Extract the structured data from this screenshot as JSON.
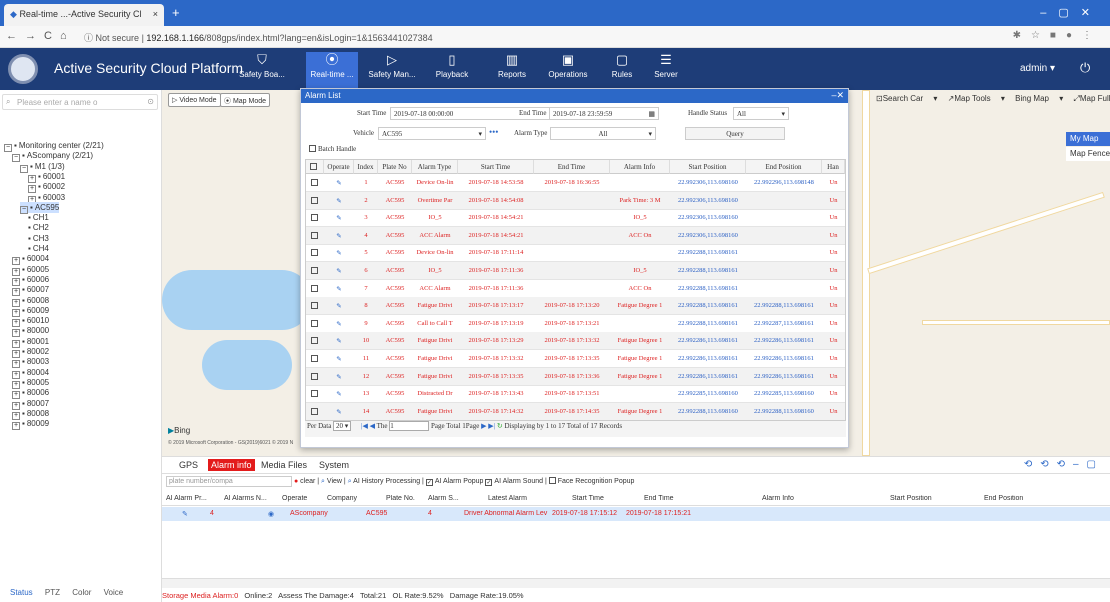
{
  "browser": {
    "tab_title": "Real-time ...-Active Security Cl",
    "tab_close": "×",
    "new_tab": "+",
    "not_secure": "Not secure",
    "url_host": "192.168.1.166",
    "url_path": "/808gps/index.html?lang=en&isLogin=1&1563441027384"
  },
  "app": {
    "title": "Active Security Cloud Platform",
    "nav": [
      {
        "label": "Safety Boa...",
        "icon": "shield-icon"
      },
      {
        "label": "Real-time ...",
        "icon": "location-pin-icon"
      },
      {
        "label": "Safety Man...",
        "icon": "play-shield-icon"
      },
      {
        "label": "Playback",
        "icon": "playback-icon"
      },
      {
        "label": "Reports",
        "icon": "bar-chart-icon"
      },
      {
        "label": "Operations",
        "icon": "operations-icon"
      },
      {
        "label": "Rules",
        "icon": "rules-icon"
      },
      {
        "label": "Server",
        "icon": "server-icon"
      }
    ],
    "user": "admin",
    "active_nav_color": "#3b6fd6",
    "header_color": "#1e3d78"
  },
  "tree": {
    "search_placeholder": "Please enter a name o",
    "items": [
      {
        "label": "Monitoring center (2/21)",
        "level": 0,
        "exp": "−",
        "sel": false
      },
      {
        "label": "AScompany (2/21)",
        "level": 1,
        "exp": "−",
        "sel": false
      },
      {
        "label": "M1 (1/3)",
        "level": 2,
        "exp": "−",
        "sel": false
      },
      {
        "label": "60001",
        "level": 3,
        "exp": "+",
        "sel": false
      },
      {
        "label": "60002",
        "level": 3,
        "exp": "+",
        "sel": false
      },
      {
        "label": "60003",
        "level": 3,
        "exp": "+",
        "sel": false
      },
      {
        "label": "AC595",
        "level": 2,
        "exp": "−",
        "sel": true
      },
      {
        "label": "CH1",
        "level": 3,
        "exp": "",
        "sel": false
      },
      {
        "label": "CH2",
        "level": 3,
        "exp": "",
        "sel": false
      },
      {
        "label": "CH3",
        "level": 3,
        "exp": "",
        "sel": false
      },
      {
        "label": "CH4",
        "level": 3,
        "exp": "",
        "sel": false
      },
      {
        "label": "60004",
        "level": 1,
        "exp": "+",
        "sel": false
      },
      {
        "label": "60005",
        "level": 1,
        "exp": "+",
        "sel": false
      },
      {
        "label": "60006",
        "level": 1,
        "exp": "+",
        "sel": false
      },
      {
        "label": "60007",
        "level": 1,
        "exp": "+",
        "sel": false
      },
      {
        "label": "60008",
        "level": 1,
        "exp": "+",
        "sel": false
      },
      {
        "label": "60009",
        "level": 1,
        "exp": "+",
        "sel": false
      },
      {
        "label": "60010",
        "level": 1,
        "exp": "+",
        "sel": false
      },
      {
        "label": "80000",
        "level": 1,
        "exp": "+",
        "sel": false
      },
      {
        "label": "80001",
        "level": 1,
        "exp": "+",
        "sel": false
      },
      {
        "label": "80002",
        "level": 1,
        "exp": "+",
        "sel": false
      },
      {
        "label": "80003",
        "level": 1,
        "exp": "+",
        "sel": false
      },
      {
        "label": "80004",
        "level": 1,
        "exp": "+",
        "sel": false
      },
      {
        "label": "80005",
        "level": 1,
        "exp": "+",
        "sel": false
      },
      {
        "label": "80006",
        "level": 1,
        "exp": "+",
        "sel": false
      },
      {
        "label": "80007",
        "level": 1,
        "exp": "+",
        "sel": false
      },
      {
        "label": "80008",
        "level": 1,
        "exp": "+",
        "sel": false
      },
      {
        "label": "80009",
        "level": 1,
        "exp": "+",
        "sel": false
      }
    ]
  },
  "left_status": [
    "Status",
    "PTZ",
    "Color",
    "Voice"
  ],
  "map": {
    "video_mode": "Video Mode",
    "map_mode": "Map Mode",
    "toolbar": [
      "Search Car",
      "Map Tools",
      "Bing Map",
      "Map Full Screen"
    ],
    "my_map": "My Map",
    "map_fence": "Map Fence",
    "bing": "Bing",
    "copyright": "© 2019 Microsoft Corporation - GS(2019)6021 © 2019 N"
  },
  "alarm": {
    "title": "Alarm List",
    "start_time_label": "Start Time",
    "start_time": "2019-07-18 00:00:00",
    "end_time_label": "End Time",
    "end_time": "2019-07-18 23:59:59",
    "handle_status_label": "Handle Status",
    "handle_status": "All",
    "vehicle_label": "Vehicle",
    "vehicle": "AC595",
    "alarm_type_label": "Alarm Type",
    "alarm_type": "All",
    "query": "Query",
    "batch": "Batch Handle",
    "columns": [
      "Operate",
      "Index",
      "Plate No",
      "Alarm Type",
      "Start Time",
      "End Time",
      "Alarm Info",
      "Start Position",
      "End Position",
      "Han"
    ],
    "rows": [
      {
        "index": "1",
        "plate": "AC595",
        "type": "Device On-lin",
        "start": "2019-07-18 14:53:58",
        "end": "2019-07-18 16:36:55",
        "info": "",
        "spos": "22.992306,113.698160",
        "epos": "22.992296,113.698148",
        "h": "Un"
      },
      {
        "index": "2",
        "plate": "AC595",
        "type": "Overtime Par",
        "start": "2019-07-18 14:54:08",
        "end": "",
        "info": "Park Time: 3 M",
        "spos": "22.992306,113.698160",
        "epos": "",
        "h": "Un"
      },
      {
        "index": "3",
        "plate": "AC595",
        "type": "IO_5",
        "start": "2019-07-18 14:54:21",
        "end": "",
        "info": "IO_5",
        "spos": "22.992306,113.698160",
        "epos": "",
        "h": "Un"
      },
      {
        "index": "4",
        "plate": "AC595",
        "type": "ACC Alarm",
        "start": "2019-07-18 14:54:21",
        "end": "",
        "info": "ACC On",
        "spos": "22.992306,113.698160",
        "epos": "",
        "h": "Un"
      },
      {
        "index": "5",
        "plate": "AC595",
        "type": "Device On-lin",
        "start": "2019-07-18 17:11:14",
        "end": "",
        "info": "",
        "spos": "22.992288,113.698161",
        "epos": "",
        "h": "Un"
      },
      {
        "index": "6",
        "plate": "AC595",
        "type": "IO_5",
        "start": "2019-07-18 17:11:36",
        "end": "",
        "info": "IO_5",
        "spos": "22.992288,113.698161",
        "epos": "",
        "h": "Un"
      },
      {
        "index": "7",
        "plate": "AC595",
        "type": "ACC Alarm",
        "start": "2019-07-18 17:11:36",
        "end": "",
        "info": "ACC On",
        "spos": "22.992288,113.698161",
        "epos": "",
        "h": "Un"
      },
      {
        "index": "8",
        "plate": "AC595",
        "type": "Fatigue Drivi",
        "start": "2019-07-18 17:13:17",
        "end": "2019-07-18 17:13:20",
        "info": "Fatigue Degree 1",
        "spos": "22.992288,113.698161",
        "epos": "22.992288,113.698161",
        "h": "Un"
      },
      {
        "index": "9",
        "plate": "AC595",
        "type": "Call to Call T",
        "start": "2019-07-18 17:13:19",
        "end": "2019-07-18 17:13:21",
        "info": "",
        "spos": "22.992288,113.698161",
        "epos": "22.992287,113.698161",
        "h": "Un"
      },
      {
        "index": "10",
        "plate": "AC595",
        "type": "Fatigue Drivi",
        "start": "2019-07-18 17:13:29",
        "end": "2019-07-18 17:13:32",
        "info": "Fatigue Degree 1",
        "spos": "22.992286,113.698161",
        "epos": "22.992286,113.698161",
        "h": "Un"
      },
      {
        "index": "11",
        "plate": "AC595",
        "type": "Fatigue Drivi",
        "start": "2019-07-18 17:13:32",
        "end": "2019-07-18 17:13:35",
        "info": "Fatigue Degree 1",
        "spos": "22.992286,113.698161",
        "epos": "22.992286,113.698161",
        "h": "Un"
      },
      {
        "index": "12",
        "plate": "AC595",
        "type": "Fatigue Drivi",
        "start": "2019-07-18 17:13:35",
        "end": "2019-07-18 17:13:36",
        "info": "Fatigue Degree 1",
        "spos": "22.992286,113.698161",
        "epos": "22.992286,113.698161",
        "h": "Un"
      },
      {
        "index": "13",
        "plate": "AC595",
        "type": "Distracted Dr",
        "start": "2019-07-18 17:13:43",
        "end": "2019-07-18 17:13:51",
        "info": "",
        "spos": "22.992285,113.698160",
        "epos": "22.992285,113.698160",
        "h": "Un"
      },
      {
        "index": "14",
        "plate": "AC595",
        "type": "Fatigue Drivi",
        "start": "2019-07-18 17:14:32",
        "end": "2019-07-18 17:14:35",
        "info": "Fatigue Degree 1",
        "spos": "22.992288,113.698160",
        "epos": "22.992288,113.698160",
        "h": "Un"
      }
    ],
    "per_data_label": "Per Data",
    "per_data": "20",
    "the_label": "The",
    "page": "1",
    "page_total": "Page  Total 1Page",
    "displaying": "Displaying by 1 to 17 Total of 17 Records"
  },
  "bottom": {
    "tabs": [
      "GPS",
      "Alarm info",
      "Media Files",
      "System"
    ],
    "plate_placeholder": "plate number/compa",
    "clear": "clear",
    "view": "View",
    "history": "AI History Processing",
    "popup": "AI Alarm Popup",
    "sound": "AI Alarm Sound",
    "face": "Face Recognition Popup",
    "columns": [
      "AI Alarm Pr...",
      "AI Alarms N...",
      "Operate",
      "Company",
      "Plate No.",
      "Alarm S...",
      "Latest Alarm",
      "Start Time",
      "End Time",
      "Alarm Info",
      "Start Position",
      "End Position"
    ],
    "row": {
      "count": "4",
      "company": "AScompany",
      "plate": "AC595",
      "alarm_s": "4",
      "latest": "Driver Abnormal Alarm Lev",
      "start": "2019-07-18 17:15:12",
      "end": "2019-07-18 17:15:21"
    }
  },
  "status": {
    "alarm": "Storage Media Alarm:0",
    "rest": "Online:2   Assess The Damage:4   Total:21   OL Rate:9.52%   Damage Rate:19.05%"
  }
}
